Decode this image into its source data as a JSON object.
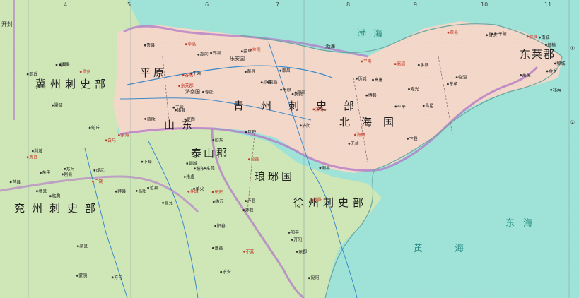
{
  "map": {
    "region_labels": {
      "ji_bu": "冀州刺史部",
      "qing_bu": "青州刺史部",
      "bei_hai": "北海国",
      "dong_lai": "东莱郡",
      "xu_bu": "徐州刺史部",
      "yan_bu": "兖州刺史部",
      "lang_ya": "琅琊国",
      "dong_shan": "山东",
      "ping_yuan": "平原",
      "ji_nan": "济南国",
      "le_an": "乐安国",
      "tai_shan": "泰山郡",
      "bo_hai": "渤海"
    },
    "sea_labels": {
      "bohai": "渤海",
      "donghai": "东海",
      "huanghai": "黄海"
    },
    "cities": [
      "东莱郡",
      "黄县",
      "牟平",
      "东牟",
      "昌阳",
      "不其",
      "胶东",
      "即墨",
      "高密",
      "夷安",
      "平寿",
      "北海",
      "临朐",
      "剧县",
      "朱虚",
      "昌安",
      "营陵",
      "都昌",
      "寿光",
      "临淄",
      "广饶",
      "乐安",
      "高苑",
      "博昌",
      "千乘",
      "济南",
      "历城",
      "东平陵",
      "著县",
      "邹平",
      "台县",
      "梁邹",
      "于陵",
      "平原",
      "高唐",
      "般县",
      "鬲县",
      "祝阿",
      "卢县",
      "蛇丘",
      "奉高",
      "嬴县",
      "博县",
      "莱芜",
      "蒙阴",
      "东安",
      "东莞",
      "莒县",
      "诸县",
      "琅邪",
      "海曲",
      "赣榆",
      "利城",
      "开阳",
      "临沂",
      "费县",
      "鲁县",
      "曲阜",
      "卞县",
      "南城",
      "东海",
      "郯县",
      "下邳",
      "即丘",
      "邳县",
      "兰陵",
      "承县",
      "昌虑",
      "薛县",
      "蕃县",
      "任城",
      "东平",
      "寿张",
      "须昌",
      "无盐",
      "章县",
      "刚县",
      "阳谷",
      "聊城",
      "东阿",
      "谷城",
      "巨野",
      "昌邑",
      "金乡",
      "方与",
      "湖陆",
      "单父",
      "成武",
      "定陶",
      "济阴",
      "离狐",
      "鄄城",
      "范县",
      "东郡",
      "濮阳",
      "白马"
    ],
    "grid_top": [
      "4",
      "5",
      "6",
      "7",
      "8",
      "9",
      "10",
      "11"
    ],
    "legend_left": "开封",
    "edge_marks": [
      "①",
      "②"
    ]
  }
}
